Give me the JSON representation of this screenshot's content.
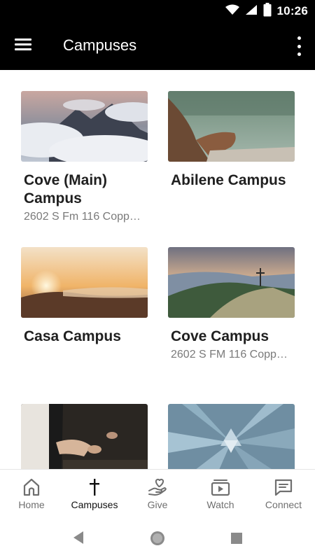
{
  "status_bar": {
    "time": "10:26"
  },
  "app_bar": {
    "title": "Campuses"
  },
  "campuses": [
    {
      "title": "Cove (Main) Campus",
      "address": "2602 S Fm 116 Copperas Cove, TX"
    },
    {
      "title": "Abilene Campus",
      "address": ""
    },
    {
      "title": "Casa Campus",
      "address": ""
    },
    {
      "title": "Cove Campus",
      "address": "2602 S FM 116 Copperas Cove, TX"
    },
    {
      "title": "",
      "address": ""
    },
    {
      "title": "",
      "address": ""
    }
  ],
  "bottom_nav": {
    "items": [
      {
        "label": "Home",
        "icon": "home-icon",
        "active": false
      },
      {
        "label": "Campuses",
        "icon": "cross-icon",
        "active": true
      },
      {
        "label": "Give",
        "icon": "hand-heart-icon",
        "active": false
      },
      {
        "label": "Watch",
        "icon": "video-icon",
        "active": false
      },
      {
        "label": "Connect",
        "icon": "message-icon",
        "active": false
      }
    ]
  },
  "system_nav": {
    "icons": [
      "back-icon",
      "home-circle-icon",
      "recents-icon"
    ]
  }
}
